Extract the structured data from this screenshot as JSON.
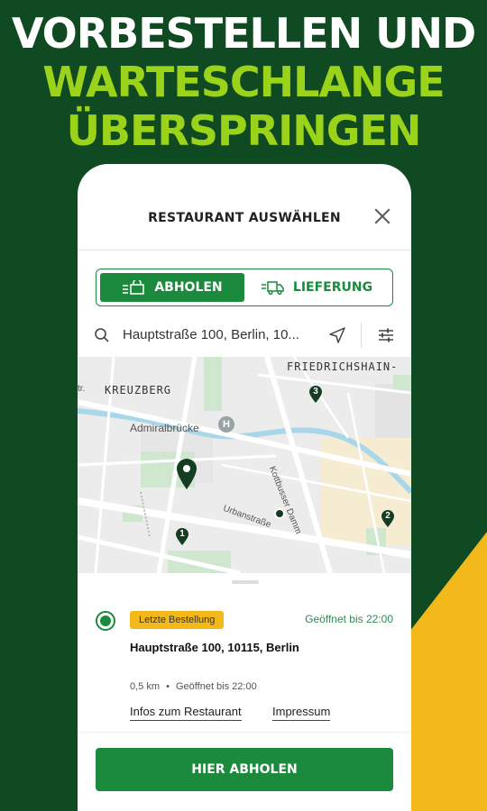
{
  "headline": {
    "line1": "VORBESTELLEN UND",
    "line2": "WARTESCHLANGE",
    "line3": "ÜBERSPRINGEN"
  },
  "modal": {
    "title": "RESTAURANT AUSWÄHLEN",
    "close_icon": "close-icon"
  },
  "toggle": {
    "pickup_label": "ABHOLEN",
    "delivery_label": "LIEFERUNG",
    "selected": "pickup"
  },
  "search": {
    "value": "Hauptstraße 100, Berlin, 10...",
    "icons": [
      "search-icon",
      "location-arrow-icon",
      "filter-sliders-icon"
    ]
  },
  "map": {
    "labels": {
      "friedrichshain": "FRIEDRICHSHAIN-",
      "kreuzberg": "KREUZBERG",
      "admiral": "Admiralbrücke",
      "urban": "Urbanstraße",
      "kottbusser": "Kottbusser Damm",
      "str": "tr."
    },
    "markers": [
      "1",
      "2",
      "3"
    ]
  },
  "restaurant": {
    "badge": "Letzte Bestellung",
    "open_status_top": "Geöffnet bis 22:00",
    "address": "Hauptstraße 100, 10115, Berlin",
    "distance": "0,5 km",
    "bullet": "•",
    "open_status": "Geöffnet bis 22:00",
    "info_link": "Infos zum Restaurant",
    "imprint_link": "Impressum"
  },
  "cta": {
    "label": "HIER ABHOLEN"
  },
  "colors": {
    "background": "#0f4a23",
    "headline_green": "#9bd31a",
    "brand_green": "#1b8a3c",
    "accent_yellow": "#f3b81a"
  }
}
